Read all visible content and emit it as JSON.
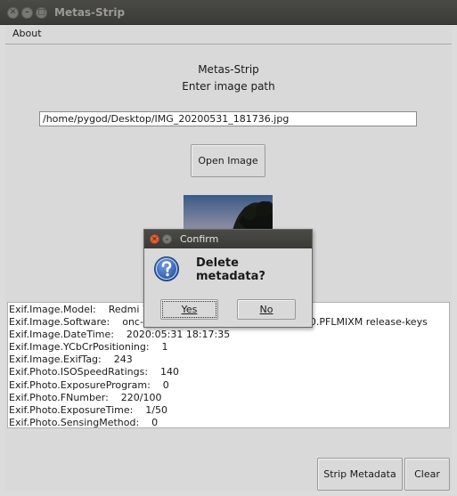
{
  "window": {
    "title": "Metas-Strip",
    "controls": [
      "✕",
      "–",
      "□"
    ]
  },
  "menubar": {
    "about_label": "About"
  },
  "main": {
    "app_name": "Metas-Strip",
    "prompt": "Enter image path",
    "path_value": "/home/pygod/Desktop/IMG_20200531_181736.jpg",
    "open_button": "Open Image",
    "output_lines": [
      "Exif.Image.Model:    Redmi 7",
      "Exif.Image.Software:    onc-user 9 PKQ1.181021.001 V10.3.6.0.PFLMIXM release-keys",
      "Exif.Image.DateTime:    2020:05:31 18:17:35",
      "Exif.Image.YCbCrPositioning:    1",
      "Exif.Image.ExifTag:    243",
      "Exif.Photo.ISOSpeedRatings:    140",
      "Exif.Photo.ExposureProgram:    0",
      "Exif.Photo.FNumber:    220/100",
      "Exif.Photo.ExposureTime:    1/50",
      "Exif.Photo.SensingMethod:    0"
    ],
    "strip_button": "Strip Metadata",
    "clear_button": "Clear"
  },
  "dialog": {
    "title": "Confirm",
    "message": "Delete metadata?",
    "icon": "question-icon",
    "yes_label": "Yes",
    "no_label": "No"
  }
}
